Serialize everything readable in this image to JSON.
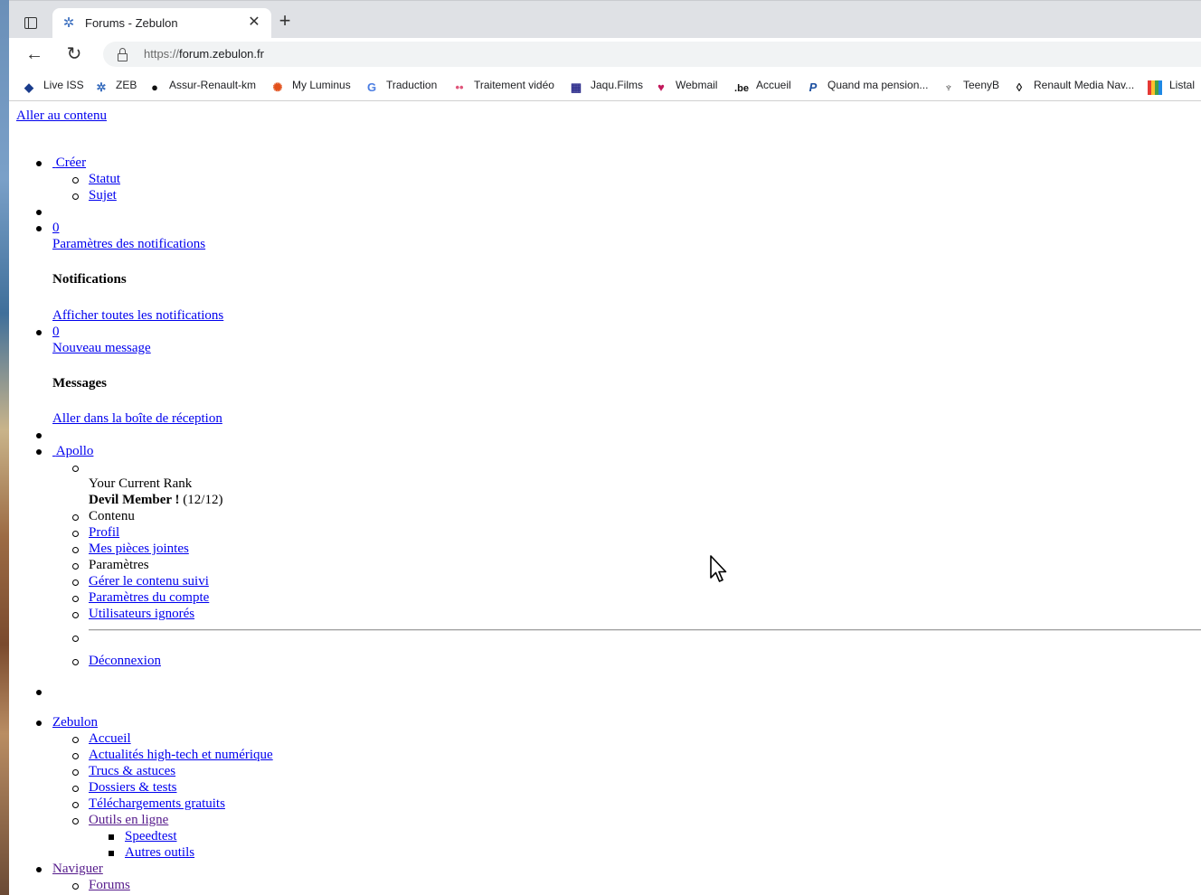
{
  "browser": {
    "tab_title": "Forums - Zebulon",
    "url_scheme": "https://",
    "url_host": "forum.zebulon.fr",
    "bookmarks": [
      {
        "label": "Live ISS",
        "icon": "diamond-icon"
      },
      {
        "label": "ZEB",
        "icon": "gear-icon"
      },
      {
        "label": "Assur-Renault-km",
        "icon": "circle-icon"
      },
      {
        "label": "My Luminus",
        "icon": "sun-icon"
      },
      {
        "label": "Traduction",
        "icon": "translate-icon"
      },
      {
        "label": "Traitement vidéo",
        "icon": "dots-icon"
      },
      {
        "label": "Jaqu.Films",
        "icon": "clapper-icon"
      },
      {
        "label": "Webmail",
        "icon": "heart-icon"
      },
      {
        "label": "Accueil",
        "icon": "be-icon"
      },
      {
        "label": "Quand ma pension...",
        "icon": "p-icon"
      },
      {
        "label": "TeenyB",
        "icon": "teeny-icon"
      },
      {
        "label": "Renault Media Nav...",
        "icon": "renault-icon"
      },
      {
        "label": "Listal",
        "icon": "bars-icon"
      }
    ]
  },
  "page": {
    "skip_link": "Aller au contenu",
    "create": {
      "label": "Créer",
      "items": [
        "Statut",
        "Sujet"
      ]
    },
    "notifications": {
      "count": "0",
      "settings_link": "Paramètres des notifications",
      "heading": "Notifications",
      "view_all": "Afficher toutes les notifications"
    },
    "messages": {
      "count": "0",
      "new_message": "Nouveau message",
      "heading": "Messages",
      "inbox": "Aller dans la boîte de réception"
    },
    "user": {
      "name": "Apollo",
      "rank_label": "Your Current Rank",
      "rank_name": "Devil Member !",
      "rank_progress": "(12/12)",
      "content_label": "Contenu",
      "profile": "Profil",
      "attachments": "Mes pièces jointes",
      "settings_label": "Paramètres",
      "followed": "Gérer le contenu suivi",
      "account": "Paramètres du compte",
      "ignored": "Utilisateurs ignorés",
      "logout": "Déconnexion"
    },
    "nav": {
      "zebulon": "Zebulon",
      "accueil": "Accueil",
      "actualites": "Actualités high-tech et numérique",
      "trucs": "Trucs & astuces",
      "dossiers": "Dossiers & tests",
      "telechargements": "Téléchargements gratuits",
      "outils": "Outils en ligne",
      "speedtest": "Speedtest",
      "autres": "Autres outils",
      "naviguer": "Naviguer",
      "forums": "Forums"
    }
  }
}
